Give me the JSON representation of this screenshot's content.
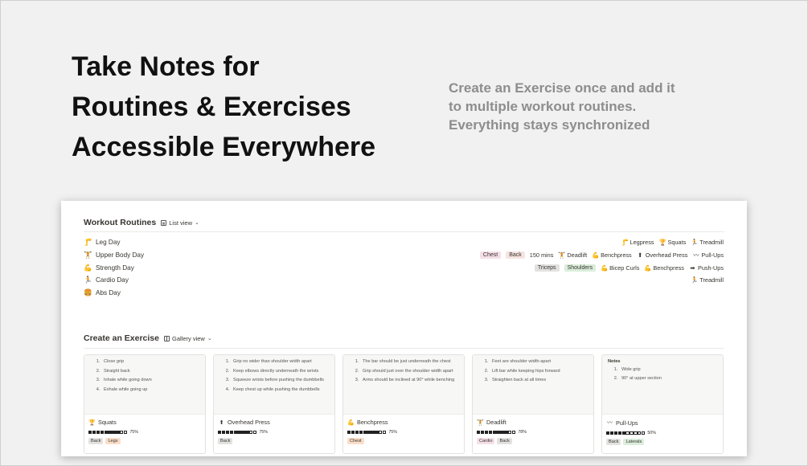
{
  "hero": {
    "title_lines": [
      "Take Notes for",
      "Routines & Exercises",
      "Accessible Everywhere"
    ],
    "subtitle_lines": [
      "Create an Exercise once and add it",
      "to multiple workout routines.",
      "Everything stays synchronized"
    ]
  },
  "routines": {
    "title": "Workout Routines",
    "view_label": "List view",
    "rows": [
      {
        "emoji": "🦵",
        "title": "Leg Day",
        "tags": [],
        "duration": "",
        "exercises": [
          {
            "emoji": "🦵",
            "name": "Legpress"
          },
          {
            "emoji": "🏆",
            "name": "Squats"
          },
          {
            "emoji": "🏃",
            "name": "Treadmill"
          }
        ]
      },
      {
        "emoji": "🏋",
        "title": "Upper Body Day",
        "tags": [
          {
            "label": "Chest",
            "color": "#f5dfe7"
          },
          {
            "label": "Back",
            "color": "#f7e3e0"
          }
        ],
        "duration": "150 mins",
        "exercises": [
          {
            "emoji": "🏋",
            "name": "Deadlift"
          },
          {
            "emoji": "💪",
            "name": "Benchpress"
          },
          {
            "emoji": "⬆",
            "name": "Overhead Press"
          },
          {
            "emoji": "〰",
            "name": "Pull-Ups"
          }
        ]
      },
      {
        "emoji": "💪",
        "title": "Strength Day",
        "tags": [
          {
            "label": "Triceps",
            "color": "#e3e2e0"
          },
          {
            "label": "Shoulders",
            "color": "#dbeddb"
          }
        ],
        "duration": "",
        "exercises": [
          {
            "emoji": "💪",
            "name": "Bicep Curls"
          },
          {
            "emoji": "💪",
            "name": "Benchpress"
          },
          {
            "emoji": "➡",
            "name": "Push-Ups"
          }
        ]
      },
      {
        "emoji": "🏃",
        "title": "Cardio Day",
        "tags": [],
        "duration": "",
        "exercises": [
          {
            "emoji": "🏃",
            "name": "Treadmill"
          }
        ]
      },
      {
        "emoji": "🍔",
        "title": "Abs Day",
        "tags": [],
        "duration": "",
        "exercises": []
      }
    ]
  },
  "exercises": {
    "title": "Create an Exercise",
    "view_label": "Gallery view",
    "cards": [
      {
        "emoji": "🏆",
        "name": "Squats",
        "notes_title": "",
        "notes": [
          "Close grip",
          "Straight back",
          "Inhale while going down",
          "Exhale while going up"
        ],
        "progress": 75,
        "progress_label": "75%",
        "tags": [
          {
            "label": "Back",
            "color": "#e3e2e0"
          },
          {
            "label": "Legs",
            "color": "#fadec9"
          }
        ]
      },
      {
        "emoji": "⬆",
        "name": "Overhead Press",
        "notes_title": "",
        "notes": [
          "Grip no wider than shoulder width apart",
          "Keep elbows directly underneath the wrists",
          "Squeeze wrists before pushing the dumbbells",
          "Keep chest up while pushing the dumbbells"
        ],
        "progress": 75,
        "progress_label": "75%",
        "tags": [
          {
            "label": "Back",
            "color": "#e3e2e0"
          }
        ]
      },
      {
        "emoji": "💪",
        "name": "Benchpress",
        "notes_title": "",
        "notes": [
          "The bar should be just underneath the chest",
          "Grip should just over the shoulder width apart",
          "Arms should be inclined at 90° while benching"
        ],
        "progress": 75,
        "progress_label": "75%",
        "tags": [
          {
            "label": "Chest",
            "color": "#fadec9"
          }
        ]
      },
      {
        "emoji": "🏋",
        "name": "Deadlift",
        "notes_title": "",
        "notes": [
          "Feet are shoulder width-apart",
          "Lift bar while keeping hips forward",
          "Straighten back at all times"
        ],
        "progress": 78,
        "progress_label": "78%",
        "tags": [
          {
            "label": "Cardio",
            "color": "#f5dfe7"
          },
          {
            "label": "Back",
            "color": "#e3e2e0"
          }
        ]
      },
      {
        "emoji": "〰",
        "name": "Pull-Ups",
        "notes_title": "Notes",
        "notes": [
          "Wide grip",
          "90° at upper section"
        ],
        "progress": 50,
        "progress_label": "50%",
        "tags": [
          {
            "label": "Back",
            "color": "#e3e2e0"
          },
          {
            "label": "Laterals",
            "color": "#dbeddb"
          }
        ]
      }
    ]
  }
}
